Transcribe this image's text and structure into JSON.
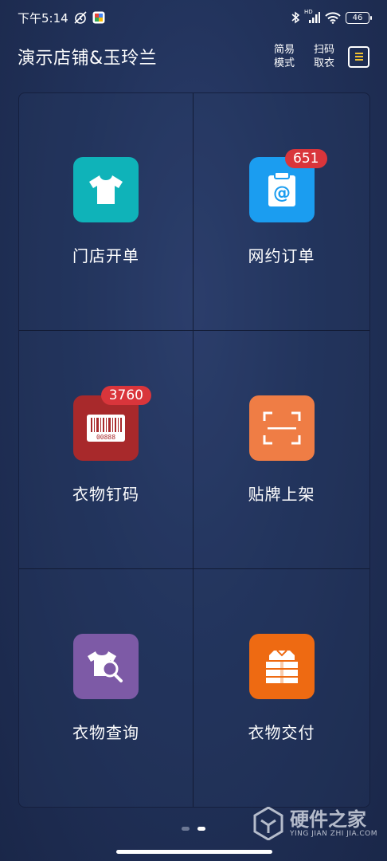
{
  "status_bar": {
    "time": "下午5:14",
    "network": "HD",
    "battery": "46"
  },
  "header": {
    "title": "演示店铺&玉玲兰",
    "simple_mode": "简易\n模式",
    "scan_pickup": "扫码\n取衣"
  },
  "tiles": [
    {
      "label": "门店开单",
      "color": "#0fb3b9",
      "icon": "tshirt-icon"
    },
    {
      "label": "网约订单",
      "color": "#1b9df0",
      "icon": "clipboard-at-icon",
      "badge": "651"
    },
    {
      "label": "衣物钉码",
      "color": "#a8292b",
      "icon": "barcode-icon",
      "badge": "3760",
      "barcode_number": "00888"
    },
    {
      "label": "贴牌上架",
      "color": "#ef7d45",
      "icon": "scan-frame-icon"
    },
    {
      "label": "衣物查询",
      "color": "#7d5aa6",
      "icon": "shirt-search-icon"
    },
    {
      "label": "衣物交付",
      "color": "#ee6a12",
      "icon": "folded-shirts-icon"
    }
  ],
  "pager": {
    "pages": 2,
    "active": 1
  },
  "watermark": {
    "name": "硬件之家",
    "sub": "YING JIAN ZHI JIA.COM"
  }
}
